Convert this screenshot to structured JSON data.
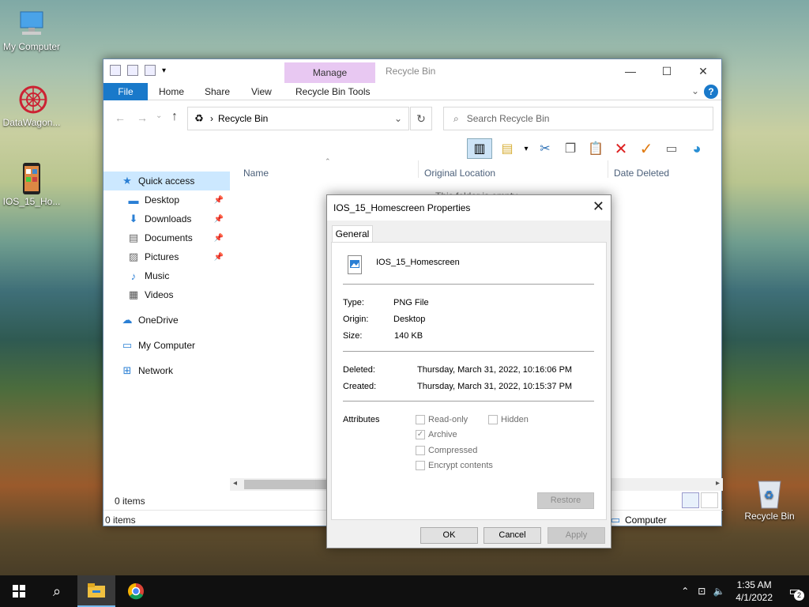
{
  "desktop": {
    "icons": [
      {
        "label": "My Computer"
      },
      {
        "label": "DataWagon..."
      },
      {
        "label": "IOS_15_Ho..."
      },
      {
        "label": "Recycle Bin"
      }
    ]
  },
  "explorer": {
    "contextual_tab": "Manage",
    "title": "Recycle Bin",
    "ribbon_tabs": [
      "File",
      "Home",
      "Share",
      "View",
      "Recycle Bin Tools"
    ],
    "address": "Recycle Bin",
    "search_placeholder": "Search Recycle Bin",
    "nav": [
      {
        "label": "Quick access"
      },
      {
        "label": "Desktop"
      },
      {
        "label": "Downloads"
      },
      {
        "label": "Documents"
      },
      {
        "label": "Pictures"
      },
      {
        "label": "Music"
      },
      {
        "label": "Videos"
      },
      {
        "label": "OneDrive"
      },
      {
        "label": "My Computer"
      },
      {
        "label": "Network"
      }
    ],
    "columns": [
      "Name",
      "Original Location",
      "Date Deleted"
    ],
    "empty_text": "This folder is empty.",
    "status_items": "0 items",
    "status_bar": "0 items",
    "status_right": "Computer"
  },
  "dialog": {
    "title": "IOS_15_Homescreen Properties",
    "tab": "General",
    "file_name": "IOS_15_Homescreen",
    "type_label": "Type:",
    "type_value": "PNG File",
    "origin_label": "Origin:",
    "origin_value": "Desktop",
    "size_label": "Size:",
    "size_value": "140 KB",
    "deleted_label": "Deleted:",
    "deleted_value": "Thursday, March 31, 2022, 10:16:06 PM",
    "created_label": "Created:",
    "created_value": "Thursday, March 31, 2022, 10:15:37 PM",
    "attributes_label": "Attributes",
    "attr_readonly": "Read-only",
    "attr_hidden": "Hidden",
    "attr_archive": "Archive",
    "attr_compressed": "Compressed",
    "attr_encrypt": "Encrypt contents",
    "restore": "Restore",
    "ok": "OK",
    "cancel": "Cancel",
    "apply": "Apply"
  },
  "taskbar": {
    "time": "1:35 AM",
    "date": "4/1/2022",
    "notif_count": "2"
  }
}
